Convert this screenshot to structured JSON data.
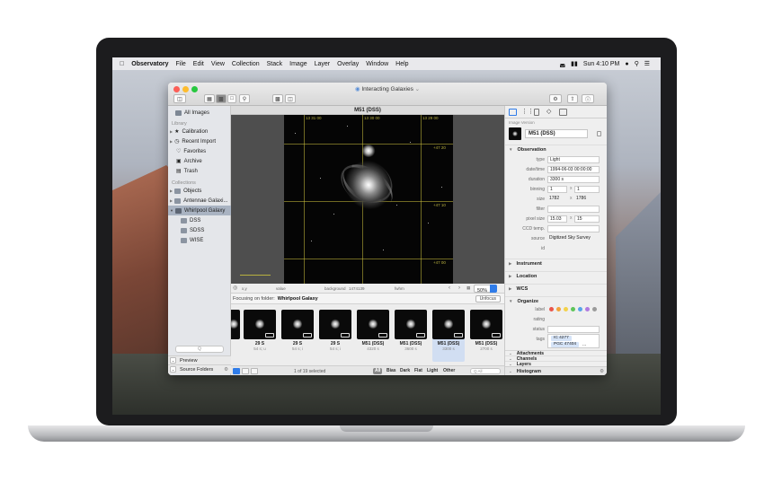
{
  "menubar": {
    "apple": "",
    "app": "Observatory",
    "items": [
      "File",
      "Edit",
      "View",
      "Collection",
      "Stack",
      "Image",
      "Layer",
      "Overlay",
      "Window",
      "Help"
    ],
    "clock": "Sun 4:10 PM"
  },
  "window": {
    "title": "Interacting Galaxies",
    "toolbar": {
      "search_icon": "magnifier-icon"
    }
  },
  "sidebar": {
    "all_images": "All Images",
    "library_header": "Library",
    "library": [
      "Calibration",
      "Recent Import",
      "Favorites",
      "Archive",
      "Trash"
    ],
    "collections_header": "Collections",
    "collections": [
      "Objects",
      "Antennae Galaxi...",
      "Whirlpool Galaxy",
      "DSS",
      "SDSS",
      "WISE"
    ],
    "search_placeholder": "Q",
    "preview": "Preview",
    "source_folders": "Source Folders"
  },
  "viewer": {
    "image_title": "M51 (DSS)",
    "status": {
      "coords": "x,y",
      "value": "value",
      "background": "background",
      "bg_value": "1474139",
      "fwhm": "fwhm"
    },
    "zoom": "50%",
    "grid_labels": [
      "13 31 00",
      "13 30 00",
      "13 29 00",
      "+47 20",
      "+47 10",
      "+47 00"
    ]
  },
  "focus": {
    "label": "Focusing on folder:",
    "folder": "Whirlpool Galaxy",
    "unfocus": "Unfocus"
  },
  "thumbnails": [
    {
      "name": "29 S",
      "sub": "54 s; u"
    },
    {
      "name": "29 S",
      "sub": "54 s; i"
    },
    {
      "name": "29 S",
      "sub": "54 s; i"
    },
    {
      "name": "M51 (DSS)",
      "sub": "4320 s"
    },
    {
      "name": "M51 (DSS)",
      "sub": "3600 s"
    },
    {
      "name": "M51 (DSS)",
      "sub": "3300 s"
    },
    {
      "name": "M51 (DSS)",
      "sub": "2700 s"
    }
  ],
  "bottombar": {
    "count": "1 of 19 selected",
    "filters": [
      "All",
      "Bias",
      "Dark",
      "Flat",
      "Light",
      "Other"
    ],
    "search_placeholder": "Q All"
  },
  "inspector": {
    "version_label": "Image Version",
    "name": "M51 (DSS)",
    "observation": "Observation",
    "fields": [
      {
        "label": "type",
        "value": "Light"
      },
      {
        "label": "date/time",
        "value": "1994-06-03 00:00:00"
      },
      {
        "label": "duration",
        "value": "3300 s"
      },
      {
        "label": "binning",
        "value": "1",
        "value2": "1"
      },
      {
        "label": "size",
        "value": "1782",
        "value2": "1786"
      },
      {
        "label": "filter",
        "value": ""
      },
      {
        "label": "pixel size",
        "value": "15.03",
        "value2": "15"
      },
      {
        "label": "CCD temp.",
        "value": ""
      },
      {
        "label": "source",
        "value": "Digitized Sky Survey"
      },
      {
        "label": "id",
        "value": ""
      }
    ],
    "times_sign": "x",
    "sections": [
      "Instrument",
      "Location",
      "WCS"
    ],
    "organize": "Organize",
    "organize_fields": {
      "label": "label",
      "rating": "rating",
      "status": "status",
      "tags": "tags"
    },
    "tags": [
      "IC 4277",
      "PGC 47404",
      "..."
    ],
    "lower_sections": [
      "Attachments",
      "Channels",
      "Layers"
    ],
    "histogram": "Histogram"
  },
  "colors": {
    "accent": "#2f7ce9",
    "labels": [
      "#e9564b",
      "#f2a33a",
      "#f3d24a",
      "#5ec55a",
      "#57a4e8",
      "#b07be0",
      "#9b9b9b"
    ]
  }
}
